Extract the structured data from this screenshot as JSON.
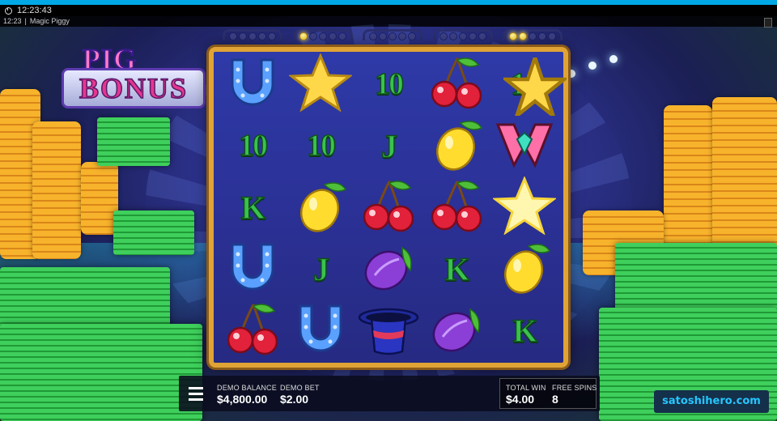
{
  "status_bar": {
    "time": "12:23:43"
  },
  "title_bar": {
    "time": "12:23",
    "app_title": "Magic Piggy"
  },
  "logo": {
    "line1": "PIG",
    "line2": "BONUS"
  },
  "indicators": [
    {
      "dots": [
        false,
        false,
        false,
        false,
        false
      ]
    },
    {
      "dots": [
        true,
        false,
        false,
        false,
        false
      ]
    },
    {
      "dots": [
        false,
        false,
        false,
        false,
        false
      ]
    },
    {
      "dots": [
        false,
        false,
        false,
        false,
        false
      ]
    },
    {
      "dots": [
        true,
        true,
        false,
        false,
        false
      ]
    }
  ],
  "reels": {
    "rows": [
      [
        "horseshoe",
        "star",
        "10",
        "cherry",
        "10"
      ],
      [
        "10",
        "10",
        "J",
        "lemon",
        "wild"
      ],
      [
        "K",
        "lemon",
        "cherry",
        "cherry",
        "star-glow"
      ],
      [
        "horseshoe",
        "J",
        "plum",
        "K",
        "lemon"
      ],
      [
        "cherry",
        "horseshoe",
        "magic-hat",
        "plum",
        "K"
      ]
    ]
  },
  "bottom_bar": {
    "balance_label": "DEMO BALANCE",
    "balance_value": "$4,800.00",
    "bet_label": "DEMO BET",
    "bet_value": "$2.00",
    "total_win_label": "TOTAL WIN",
    "total_win_value": "$4.00",
    "free_spins_label": "FREE SPINS",
    "free_spins_value": "8"
  },
  "watermark": {
    "text": "satoshihero.com"
  },
  "colors": {
    "accent_blue": "#00a8e6",
    "frame_gold": "#e0a436",
    "brand_text": "#26c6ff"
  }
}
